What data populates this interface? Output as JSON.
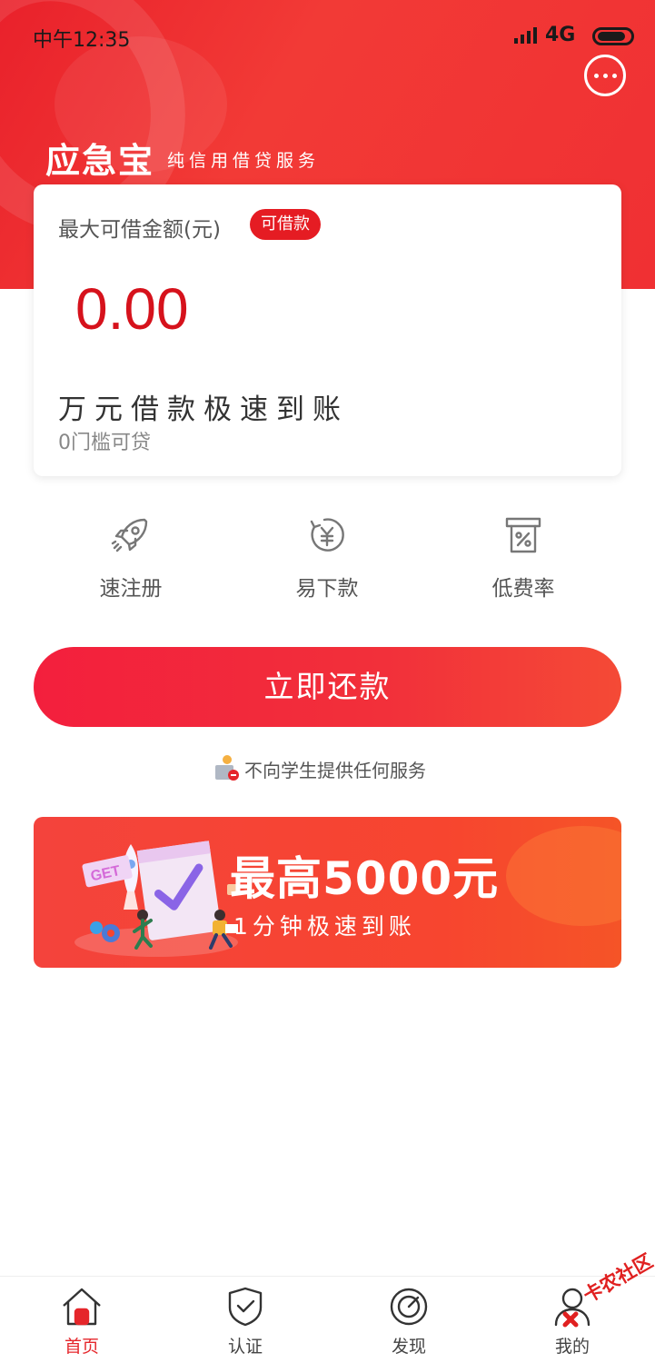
{
  "status_bar": {
    "time": "中午12:35",
    "network": "4G"
  },
  "header": {
    "title": "应急宝",
    "subtitle": "纯信用借贷服务"
  },
  "card": {
    "label": "最大可借金额(元)",
    "badge": "可借款",
    "amount": "0.00",
    "slogan": "万元借款极速到账",
    "note": "0门槛可贷"
  },
  "features": [
    {
      "label": "速注册",
      "icon": "rocket-icon"
    },
    {
      "label": "易下款",
      "icon": "yuan-cycle-icon"
    },
    {
      "label": "低费率",
      "icon": "percent-receipt-icon"
    }
  ],
  "repay_button": {
    "label": "立即还款"
  },
  "notice": {
    "text": "不向学生提供任何服务"
  },
  "promo_banner": {
    "title": "最高5000元",
    "subtitle": "1分钟极速到账",
    "illustration_text": "GET"
  },
  "tabbar": [
    {
      "label": "首页",
      "icon": "home-icon",
      "active": true
    },
    {
      "label": "认证",
      "icon": "shield-check-icon",
      "active": false
    },
    {
      "label": "发现",
      "icon": "compass-icon",
      "active": false
    },
    {
      "label": "我的",
      "icon": "user-icon",
      "active": false
    }
  ],
  "watermark": {
    "text": "卡农社区"
  },
  "colors": {
    "brand_red": "#e5262b",
    "amount_red": "#d6121c",
    "banner_orange": "#f7452f"
  }
}
